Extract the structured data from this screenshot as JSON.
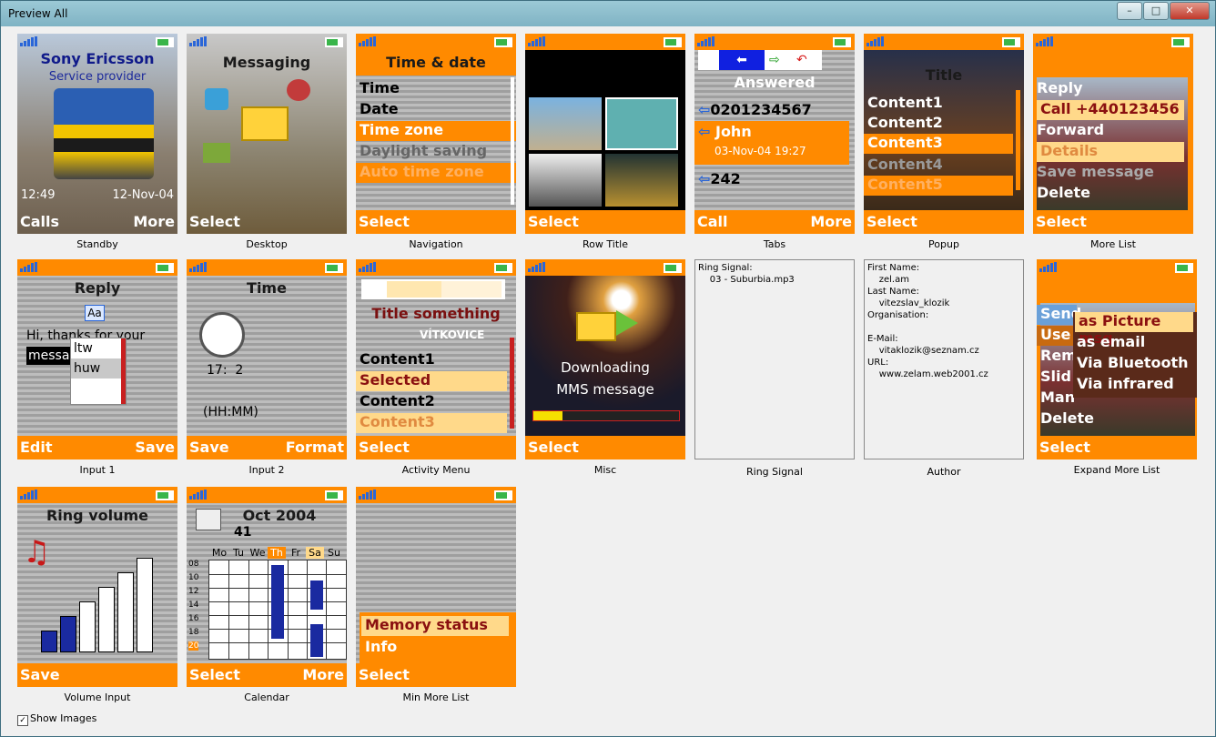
{
  "window": {
    "title": "Preview All",
    "min": "–",
    "max": "□",
    "close": "✕"
  },
  "cells": {
    "standby": {
      "caption": "Standby",
      "operator": "Sony Ericsson",
      "provider": "Service provider",
      "time": "12:49",
      "date": "12-Nov-04",
      "left": "Calls",
      "right": "More"
    },
    "desktop": {
      "caption": "Desktop",
      "title": "Messaging",
      "left": "Select"
    },
    "navigation": {
      "caption": "Navigation",
      "title": "Time & date",
      "items": [
        "Time",
        "Date",
        "Time zone",
        "Daylight saving",
        "Auto time zone"
      ],
      "left": "Select"
    },
    "rowtitle": {
      "caption": "Row Title",
      "left": "Select"
    },
    "tabs": {
      "caption": "Tabs",
      "header": "Answered",
      "num1": "0201234567",
      "name": "John",
      "datetime": "03-Nov-04 19:27",
      "num2": "242",
      "left": "Call",
      "right": "More"
    },
    "popup": {
      "caption": "Popup",
      "title": "Title",
      "items": [
        "Content1",
        "Content2",
        "Content3",
        "Content4",
        "Content5"
      ],
      "left": "Select"
    },
    "morelist": {
      "caption": "More List",
      "items": [
        "Reply",
        "Call +440123456",
        "Forward",
        "Details",
        "Save message",
        "Delete"
      ],
      "left": "Select"
    },
    "input1": {
      "caption": "Input 1",
      "title": "Reply",
      "mode": "Aa",
      "text1": "Hi, thanks for your",
      "text2": "messa",
      "suggest": [
        "ltw",
        "huw"
      ],
      "left": "Edit",
      "right": "Save"
    },
    "input2": {
      "caption": "Input 2",
      "title": "Time",
      "value": "17:  2",
      "format": "(HH:MM)",
      "left": "Save",
      "right": "Format"
    },
    "activity": {
      "caption": "Activity Menu",
      "title": "Title something",
      "banner": "VÍTKOVICE",
      "items": [
        "Content1",
        "Selected",
        "Content2",
        "Content3"
      ],
      "left": "Select"
    },
    "misc": {
      "caption": "Misc",
      "line1": "Downloading",
      "line2": "MMS message",
      "progress": 0.2,
      "left": "Select"
    },
    "ringsignal": {
      "caption": "Ring Signal",
      "label": "Ring Signal:",
      "value": "03 - Suburbia.mp3"
    },
    "author": {
      "caption": "Author",
      "first_label": "First Name:",
      "first": "zel.am",
      "last_label": "Last Name:",
      "last": "vitezslav_klozik",
      "org_label": "Organisation:",
      "email_label": "E-Mail:",
      "email": "vitaklozik@seznam.cz",
      "url_label": "URL:",
      "url": "www.zelam.web2001.cz"
    },
    "expand": {
      "caption": "Expand More List",
      "behind": [
        "Send",
        "Use",
        "Rem",
        "Slid",
        "Man",
        "Delete"
      ],
      "sub": [
        "as Picture msg",
        "as email",
        "Via Bluetooth",
        "Via infrared"
      ],
      "left": "Select"
    },
    "volume": {
      "caption": "Volume Input",
      "title": "Ring volume",
      "level": 2,
      "levels": 6,
      "left": "Save"
    },
    "calendar": {
      "caption": "Calendar",
      "month": "Oct 2004",
      "week": "41",
      "days": [
        "Mo",
        "Tu",
        "We",
        "Th",
        "Fr",
        "Sa",
        "Su"
      ],
      "hours": [
        "08",
        "10",
        "12",
        "14",
        "16",
        "18",
        "20"
      ],
      "left": "Select",
      "right": "More"
    },
    "minmore": {
      "caption": "Min More List",
      "items": [
        "Memory status",
        "Info"
      ],
      "left": "Select"
    }
  },
  "show_images": "Show Images"
}
